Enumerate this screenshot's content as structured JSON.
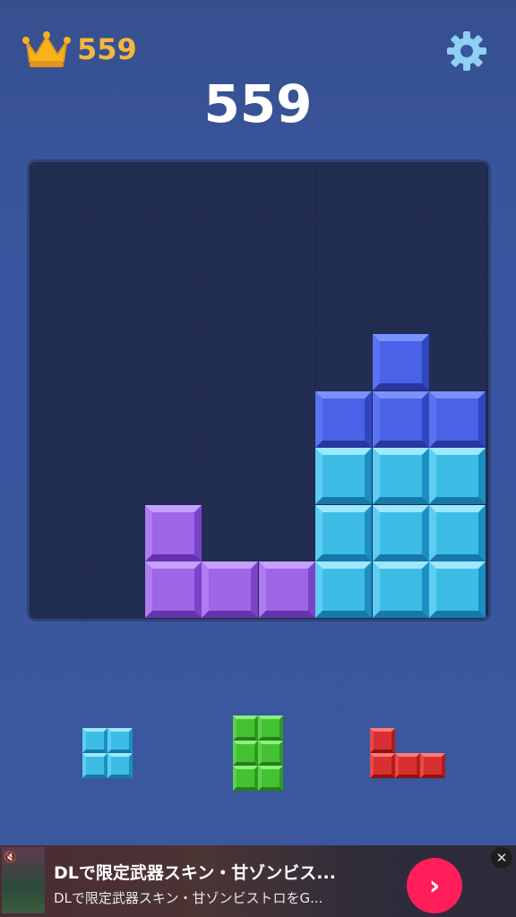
{
  "header": {
    "best_score": "559",
    "score": "559",
    "crown_icon": "crown-icon",
    "settings_icon": "gear-icon"
  },
  "board": {
    "rows": 8,
    "cols": 8,
    "blocks": [
      {
        "row": 3,
        "col": 6,
        "color": "blue"
      },
      {
        "row": 4,
        "col": 5,
        "color": "blue"
      },
      {
        "row": 4,
        "col": 6,
        "color": "blue"
      },
      {
        "row": 4,
        "col": 7,
        "color": "blue"
      },
      {
        "row": 5,
        "col": 5,
        "color": "cyan"
      },
      {
        "row": 5,
        "col": 6,
        "color": "cyan"
      },
      {
        "row": 5,
        "col": 7,
        "color": "cyan"
      },
      {
        "row": 6,
        "col": 2,
        "color": "purple"
      },
      {
        "row": 6,
        "col": 5,
        "color": "cyan"
      },
      {
        "row": 6,
        "col": 6,
        "color": "cyan"
      },
      {
        "row": 6,
        "col": 7,
        "color": "cyan"
      },
      {
        "row": 7,
        "col": 2,
        "color": "purple"
      },
      {
        "row": 7,
        "col": 3,
        "color": "purple"
      },
      {
        "row": 7,
        "col": 4,
        "color": "purple"
      },
      {
        "row": 7,
        "col": 5,
        "color": "cyan"
      },
      {
        "row": 7,
        "col": 6,
        "color": "cyan"
      },
      {
        "row": 7,
        "col": 7,
        "color": "cyan"
      }
    ]
  },
  "colors": {
    "blue": {
      "top": "#7a92ff",
      "side": "#3145c0",
      "face": "#4a62e6",
      "left": "#5b73f0",
      "bottom": "#2836a0"
    },
    "cyan": {
      "top": "#9ee8ff",
      "side": "#1b8fc2",
      "face": "#3dbde6",
      "left": "#5fcdf2",
      "bottom": "#157aa8"
    },
    "purple": {
      "top": "#c6a0ff",
      "side": "#7a44c8",
      "face": "#9e66e6",
      "left": "#b07af0",
      "bottom": "#6534ad"
    },
    "green": {
      "top": "#8cf07a",
      "side": "#2f9a22",
      "face": "#44c233",
      "left": "#5cd24a",
      "bottom": "#237f18"
    },
    "red": {
      "top": "#ff7a7a",
      "side": "#b01c1c",
      "face": "#d83030",
      "left": "#e84848",
      "bottom": "#8f1212"
    }
  },
  "tray": [
    {
      "name": "tray-piece-square",
      "color": "cyan",
      "cells": [
        [
          0,
          0
        ],
        [
          0,
          1
        ],
        [
          1,
          0
        ],
        [
          1,
          1
        ]
      ]
    },
    {
      "name": "tray-piece-column",
      "color": "green",
      "cells": [
        [
          0,
          0
        ],
        [
          0,
          1
        ],
        [
          1,
          0
        ],
        [
          1,
          1
        ],
        [
          2,
          0
        ],
        [
          2,
          1
        ]
      ]
    },
    {
      "name": "tray-piece-l",
      "color": "red",
      "cells": [
        [
          0,
          0
        ],
        [
          1,
          0
        ],
        [
          1,
          1
        ],
        [
          1,
          2
        ]
      ]
    }
  ],
  "ad": {
    "title": "DLで限定武器スキン・甘ゾンビス...",
    "description": "DLで限定武器スキン・甘ゾンビストロをG...",
    "cta_icon": "chevron-right-icon",
    "close_icon": "close-icon",
    "mute_icon": "mute-icon"
  }
}
